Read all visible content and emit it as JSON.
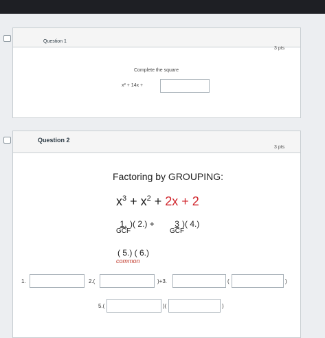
{
  "q1": {
    "title": "Question 1",
    "points": "3 pts",
    "instruction": "Complete the square",
    "expression": "x² + 14x +"
  },
  "q2": {
    "title": "Question 2",
    "points": "3 pts",
    "heading": "Factoring by GROUPING:",
    "poly": {
      "a": "x",
      "a_exp": "3",
      "plus1": " + ",
      "b": "x",
      "b_exp": "2",
      "plus2": " + ",
      "c": "2x + 2"
    },
    "group1_num": "1.",
    "group1_rest": ")( 2.) +",
    "group2_num": "3",
    "group2_rest": ")( 4.)",
    "gcf_label": "GCF",
    "line3_open": "(",
    "line3_mid": "5.) ( 6.)",
    "common_label": "common",
    "answers": {
      "l1": "1.",
      "l2": "2.(",
      "l3": ")+3.",
      "l4": "(",
      "l4_end": ")",
      "l5": "5.(",
      "l6": ")(",
      "l6_end": ")"
    }
  },
  "colors": {
    "red_term": "#d0242b",
    "common": "#c0392b"
  }
}
